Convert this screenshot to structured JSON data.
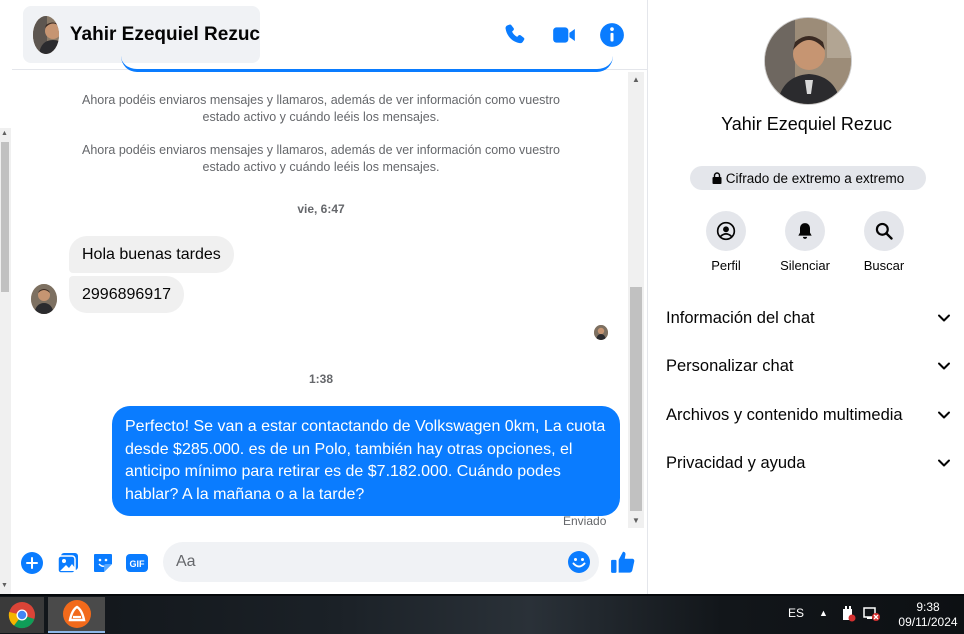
{
  "chat_header": {
    "contact_name": "Yahir Ezequiel Rezuc"
  },
  "messages": {
    "system_notice_1": "Ahora podéis enviaros mensajes y llamaros, además de ver información como vuestro estado activo y cuándo leéis los mensajes.",
    "system_notice_2": "Ahora podéis enviaros mensajes y llamaros, además de ver información como vuestro estado activo y cuándo leéis los mensajes.",
    "time_separator_1": "vie, 6:47",
    "incoming_1": "Hola buenas tardes",
    "incoming_2": "2996896917",
    "time_separator_2": "1:38",
    "outgoing_1": "Perfecto!  Se van a estar contactando de Volkswagen 0km, La cuota desde $285.000. es de un Polo, también hay otras opciones, el anticipo mínimo para retirar es de $7.182.000. Cuándo podes hablar? A la mañana o a la tarde?",
    "sent_status": "Enviado"
  },
  "composer": {
    "placeholder": "Aa",
    "gif_label": "GIF"
  },
  "info_panel": {
    "name": "Yahir Ezequiel Rezuc",
    "encryption_label": "Cifrado de extremo a extremo",
    "actions": [
      {
        "label": "Perfil",
        "icon": "profile-icon"
      },
      {
        "label": "Silenciar",
        "icon": "bell-icon"
      },
      {
        "label": "Buscar",
        "icon": "search-icon"
      }
    ],
    "sections": [
      {
        "label": "Información del chat"
      },
      {
        "label": "Personalizar chat"
      },
      {
        "label": "Archivos y contenido multimedia"
      },
      {
        "label": "Privacidad y ayuda"
      }
    ]
  },
  "taskbar": {
    "language": "ES",
    "time": "9:38",
    "date": "09/11/2024"
  },
  "colors": {
    "accent": "#0a7cff",
    "incoming_bubble": "#f0f0f0",
    "muted_text": "#65676b"
  }
}
